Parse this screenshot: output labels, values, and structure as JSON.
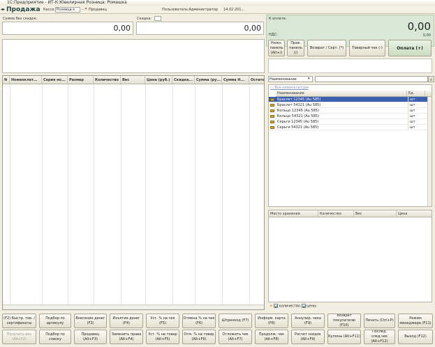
{
  "window": {
    "title": "1С:Предприятие - ИТ-К:Ювелирная Розница: Ромашка"
  },
  "header": {
    "form_title": "Продажа",
    "kassa_label": "Касса:",
    "kassa_value": "Розница к",
    "warehouse_value": "Продавец",
    "user_text": "Пользователь:Администратор",
    "date_text": "14.02.201..."
  },
  "sums": {
    "no_discount_label": "Сумма без скидок:",
    "no_discount_value": "0,00",
    "discount_label": "Скидка:",
    "discount_value": "0,00",
    "to_pay_label": "К оплате:",
    "to_pay_value": "0,00",
    "vat_label": "НДС:",
    "vat_value": "0,00"
  },
  "payment_buttons": {
    "numpad": "Нижн. панель (Alt+/)",
    "right_panel": "Прав. панель (/)",
    "return": "Возврат / Серт. (*)",
    "receipt": "Товарный чек (-)",
    "pay": "Оплата (+)"
  },
  "items_table": {
    "n_col": "N",
    "columns": [
      "Номенклат...",
      "Серия но...",
      "Размер",
      "Количество",
      "Вес",
      "Цена (руб.)",
      "Скидка...",
      "Сумма (ру...",
      "Сумма Н...",
      "Остаток"
    ]
  },
  "catalog": {
    "search_mode": "Наименование",
    "search_placeholder": "",
    "all_text": "Вся номенклатура",
    "col_name": "Наименование",
    "col_unit": "Ед.",
    "items": [
      {
        "name": "Браслет 12345 (Au 585)",
        "unit": "шт",
        "selected": true
      },
      {
        "name": "Браслет 54321 (Au 585)",
        "unit": "шт",
        "selected": false
      },
      {
        "name": "Кольцо 12345 (Au 585)",
        "unit": "шт",
        "selected": false
      },
      {
        "name": "Кольцо 54321 (Au 585)",
        "unit": "шт",
        "selected": false
      },
      {
        "name": "Серьги 12345 (Au 585)",
        "unit": "шт",
        "selected": false
      },
      {
        "name": "Серьги 54321 (Au 585)",
        "unit": "шт",
        "selected": false
      }
    ]
  },
  "stock": {
    "columns": [
      "Место хранения",
      "Количество",
      "Вес",
      "Цена"
    ],
    "show_qty": "количество",
    "show_price": "цены"
  },
  "bottom_buttons": {
    "row1": [
      "(F2) Быстр. тов. / сертификаты",
      "Подбор по артикулу",
      "Внесение денег (F3)",
      "Изъятие денег (F4)",
      "Уст. % на чек (F5)",
      "Отмена % на чек (F6)",
      "Штрихкод (F7)",
      "Информ. карта (F8)",
      "Аннулир. чека (F9)",
      "Возврат покупателю (F10)",
      "Печать (Ctrl+P)",
      "Режим менеджера (F11)"
    ],
    "row2": [
      "Получить вес (Alt+F2)",
      "Подбор по списку",
      "Продавец (Alt+F3)",
      "Заменить права (Alt+F4)",
      "Уст. % на товар (Alt+F5)",
      "Отм. % на товар (Alt+F6)",
      "Отложить чек (Alt+F7)",
      "Продолж. чек (Alt+F8)",
      "Расчет скидок (Alt+F9)",
      "Купоны (Alt+F11)",
      "Послед. след.чек (Alt+F12)",
      "Выход (F12)"
    ]
  },
  "colors": {
    "accent": "#3a5eb0",
    "green_panel": "#d9e8d4"
  }
}
